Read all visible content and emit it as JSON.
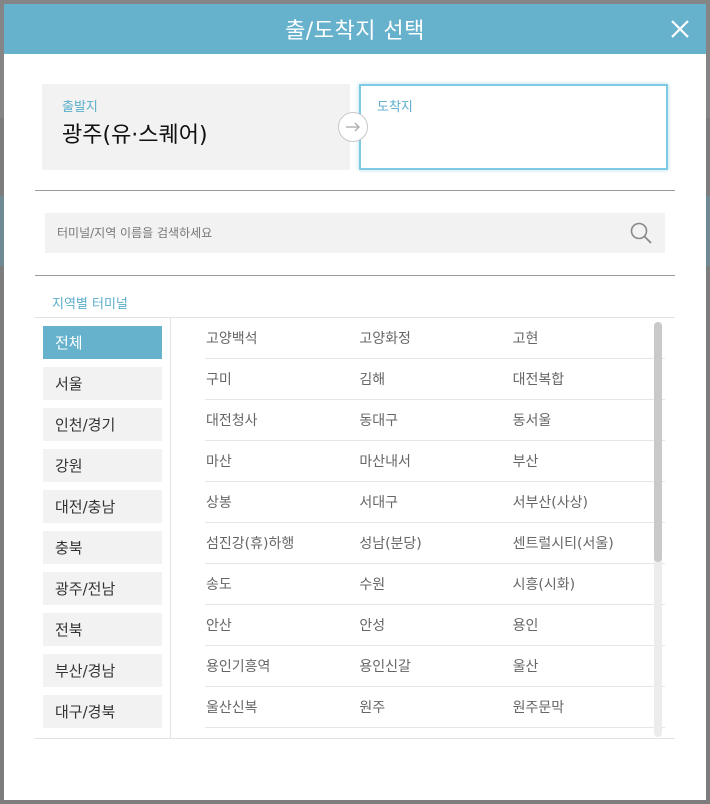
{
  "modal": {
    "title": "출/도착지 선택"
  },
  "route": {
    "from_label": "출발지",
    "from_value": "광주(유·스퀘어)",
    "to_label": "도착지",
    "to_value": ""
  },
  "search": {
    "placeholder": "터미널/지역 이름을 검색하세요"
  },
  "section": {
    "title": "지역별 터미널"
  },
  "regions": [
    {
      "label": "전체",
      "active": true
    },
    {
      "label": "서울"
    },
    {
      "label": "인천/경기"
    },
    {
      "label": "강원"
    },
    {
      "label": "대전/충남"
    },
    {
      "label": "충북"
    },
    {
      "label": "광주/전남"
    },
    {
      "label": "전북"
    },
    {
      "label": "부산/경남"
    },
    {
      "label": "대구/경북"
    }
  ],
  "terminals": [
    [
      "고양백석",
      "고양화정",
      "고현"
    ],
    [
      "구미",
      "김해",
      "대전복합"
    ],
    [
      "대전청사",
      "동대구",
      "동서울"
    ],
    [
      "마산",
      "마산내서",
      "부산"
    ],
    [
      "상봉",
      "서대구",
      "서부산(사상)"
    ],
    [
      "섬진강(휴)하행",
      "성남(분당)",
      "센트럴시티(서울)"
    ],
    [
      "송도",
      "수원",
      "시흥(시화)"
    ],
    [
      "안산",
      "안성",
      "용인"
    ],
    [
      "용인기흥역",
      "용인신갈",
      "울산"
    ],
    [
      "울산신복",
      "원주",
      "원주문막"
    ]
  ],
  "colors": {
    "accent": "#66b2cd",
    "accent_text": "#5aaecb",
    "to_box_border": "#7ccbe3"
  },
  "icons": {
    "close": "close-icon",
    "arrow": "arrow-right-icon",
    "search": "search-icon"
  }
}
